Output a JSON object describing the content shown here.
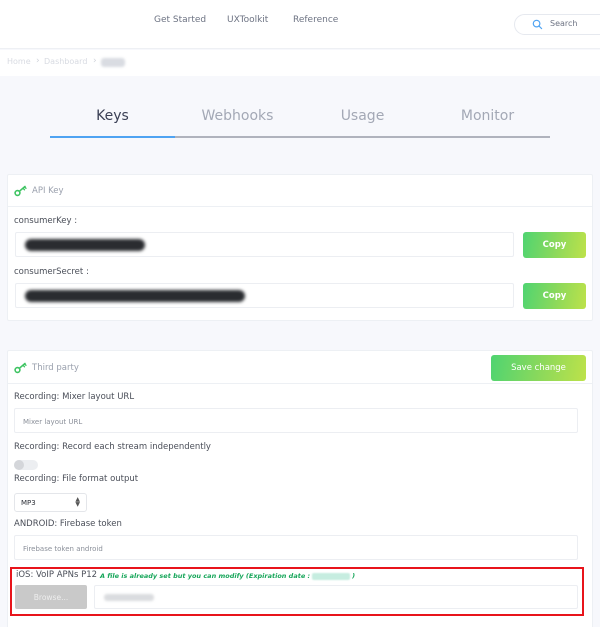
{
  "topnav": {
    "links": [
      "Get Started",
      "UXToolkit",
      "Reference"
    ],
    "search_placeholder": "Search"
  },
  "breadcrumb": {
    "items": [
      "Home",
      "Dashboard"
    ],
    "separator": "›",
    "current_redacted": true
  },
  "tabs": {
    "items": [
      "Keys",
      "Webhooks",
      "Usage",
      "Monitor"
    ],
    "active": "Keys",
    "active_color": "#4fa3f2"
  },
  "api_key_card": {
    "title": "API Key",
    "icon": "key-icon",
    "fields": [
      {
        "label": "consumerKey :",
        "value_redacted": true,
        "button": "Copy"
      },
      {
        "label": "consumerSecret :",
        "value_redacted": true,
        "button": "Copy"
      }
    ]
  },
  "third_party_card": {
    "title": "Third party",
    "icon": "key-icon",
    "save_button": "Save change",
    "mixer_url": {
      "label": "Recording: Mixer layout URL",
      "placeholder": "Mixer layout URL",
      "value": ""
    },
    "record_each": {
      "label": "Recording: Record each stream independently",
      "enabled": false
    },
    "file_format": {
      "label": "Recording: File format output",
      "selected": "MP3"
    },
    "firebase": {
      "label": "ANDROID: Firebase token",
      "placeholder": "Firebase token android",
      "value": ""
    },
    "ios_voip": {
      "label": "iOS: VoIP APNs P12",
      "note_prefix": "A file is already set but you can modify (Expiration date :",
      "note_suffix": ")",
      "expiration_redacted": true,
      "browse_button": "Browse...",
      "filename_redacted": true
    }
  },
  "colors": {
    "accent_green_start": "#4fd471",
    "accent_green_end": "#bde24a",
    "note_green": "#17a65a",
    "highlight_red": "#e8141b"
  }
}
